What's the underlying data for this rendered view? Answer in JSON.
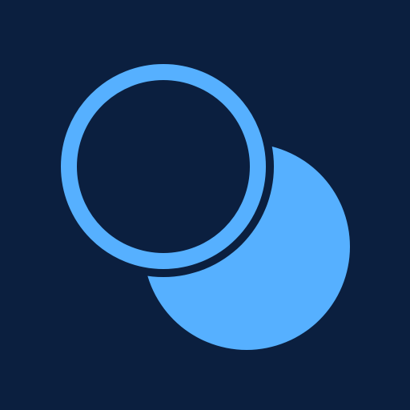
{
  "icon": {
    "name": "overlapping-circles-icon",
    "colors": {
      "background": "#0b1f3f",
      "accent": "#56b0ff"
    }
  }
}
